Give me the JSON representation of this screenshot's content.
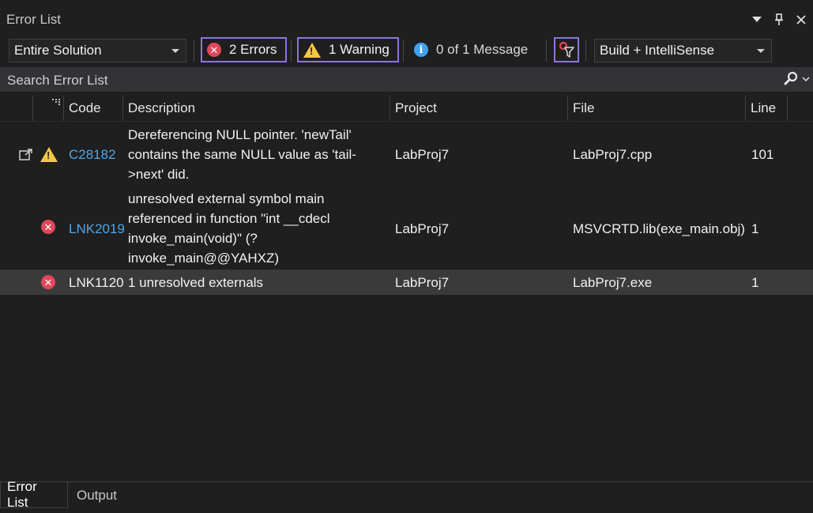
{
  "window": {
    "title": "Error List",
    "controls": [
      "dropdown-icon",
      "pin-icon",
      "close-icon"
    ]
  },
  "toolbar": {
    "scope_value": "Entire Solution",
    "errors_label": "2 Errors",
    "warnings_label": "1 Warning",
    "messages_label": "0 of 1 Message",
    "build_source_value": "Build + IntelliSense"
  },
  "search": {
    "placeholder": "Search Error List"
  },
  "table": {
    "columns": {
      "code": "Code",
      "description": "Description",
      "project": "Project",
      "file": "File",
      "line": "Line"
    },
    "rows": [
      {
        "severity": "warning",
        "code": "C28182",
        "description_lines": [
          "Dereferencing NULL pointer. 'newTail'",
          "contains the same NULL value as 'tail-",
          ">next' did."
        ],
        "project": "LabProj7",
        "file": "LabProj7.cpp",
        "line": "101"
      },
      {
        "severity": "error",
        "code": "LNK2019",
        "description_lines": [
          "unresolved external symbol main",
          "referenced in function \"int __cdecl",
          "invoke_main(void)\" (?",
          "invoke_main@@YAHXZ)"
        ],
        "project": "LabProj7",
        "file": "MSVCRTD.lib(exe_main.obj)",
        "line": "1"
      },
      {
        "severity": "error",
        "code": "LNK1120",
        "description_lines": [
          "1 unresolved externals"
        ],
        "project": "LabProj7",
        "file": "LabProj7.exe",
        "line": "1"
      }
    ]
  },
  "bottom_tabs": {
    "active": "Error List",
    "inactive": "Output"
  },
  "colors": {
    "background": "#1f1f1f",
    "accent_border": "#8e74e0",
    "link": "#4fa6e8",
    "error": "#e0475a",
    "warning": "#f2c744",
    "info": "#3fa2f7"
  }
}
